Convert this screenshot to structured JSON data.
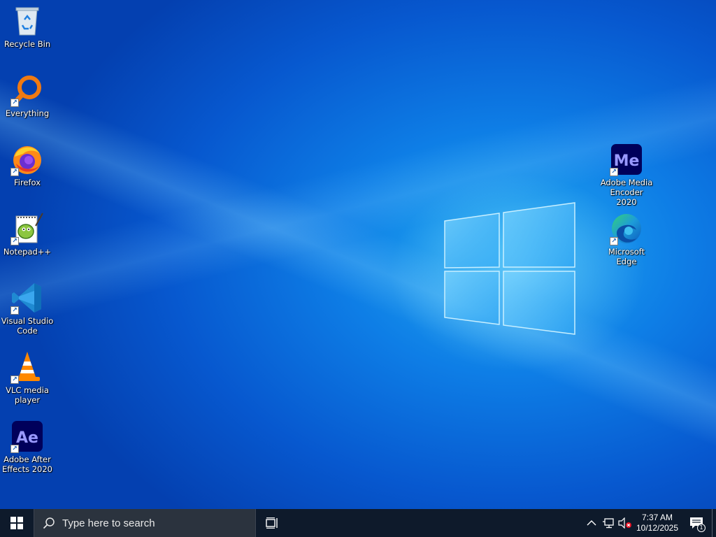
{
  "desktop": {
    "icons": [
      {
        "label": "Recycle Bin",
        "icon": "recycle-bin-icon",
        "shortcut": false
      },
      {
        "label": "Everything",
        "icon": "everything-search-icon",
        "shortcut": true
      },
      {
        "label": "Firefox",
        "icon": "firefox-icon",
        "shortcut": true
      },
      {
        "label": "Notepad++",
        "icon": "notepad-plus-plus-icon",
        "shortcut": true
      },
      {
        "label": "Visual Studio\nCode",
        "icon": "vscode-icon",
        "shortcut": true
      },
      {
        "label": "VLC media\nplayer",
        "icon": "vlc-icon",
        "shortcut": true
      },
      {
        "label": "Adobe After\nEffects 2020",
        "icon": "after-effects-icon",
        "shortcut": true,
        "glyph": "Ae"
      },
      {
        "label": "Adobe Media\nEncoder 2020",
        "icon": "media-encoder-icon",
        "shortcut": true,
        "glyph": "Me"
      },
      {
        "label": "Microsoft\nEdge",
        "icon": "edge-icon",
        "shortcut": true
      }
    ]
  },
  "taskbar": {
    "search_placeholder": "Type here to search",
    "clock_time": "7:37 AM",
    "clock_date": "10/12/2025",
    "notification_count": "1"
  },
  "colors": {
    "taskbar_bg": "#0e1a2b",
    "search_bg": "#2b333e",
    "desktop_accent": "#0e7ee6"
  }
}
